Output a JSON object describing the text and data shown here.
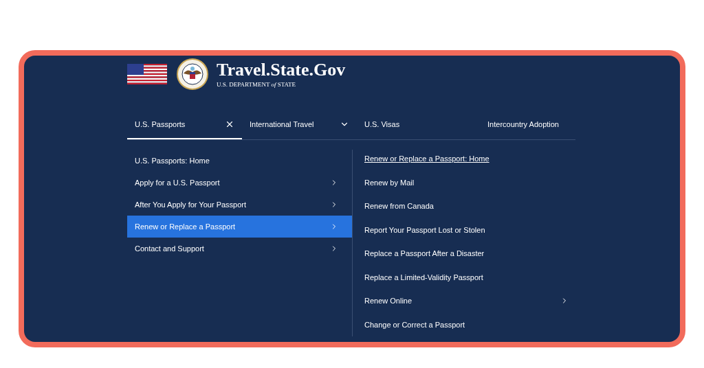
{
  "header": {
    "title": "Travel.State.Gov",
    "subtitle": "U.S. DEPARTMENT *of* STATE"
  },
  "tabs": [
    {
      "label": "U.S. Passports",
      "selected": true,
      "kind": "closable"
    },
    {
      "label": "International Travel",
      "selected": false,
      "kind": "dropdown"
    },
    {
      "label": "U.S. Visas",
      "selected": false,
      "kind": "plain"
    },
    {
      "label": "Intercountry Adoption",
      "selected": false,
      "kind": "plain"
    }
  ],
  "menu": [
    {
      "label": "U.S. Passports: Home",
      "selected": false,
      "has_submenu": false
    },
    {
      "label": "Apply for a U.S. Passport",
      "selected": false,
      "has_submenu": true
    },
    {
      "label": "After You Apply for Your Passport",
      "selected": false,
      "has_submenu": true
    },
    {
      "label": "Renew or Replace a Passport",
      "selected": true,
      "has_submenu": true
    },
    {
      "label": "Contact and Support",
      "selected": false,
      "has_submenu": true
    }
  ],
  "submenu": [
    {
      "label": "Renew or Replace a Passport: Home",
      "underlined": true,
      "has_submenu": false
    },
    {
      "label": "Renew by Mail",
      "underlined": false,
      "has_submenu": false
    },
    {
      "label": "Renew from Canada",
      "underlined": false,
      "has_submenu": false
    },
    {
      "label": "Report Your Passport Lost or Stolen",
      "underlined": false,
      "has_submenu": false
    },
    {
      "label": "Replace a Passport After a Disaster",
      "underlined": false,
      "has_submenu": false
    },
    {
      "label": "Replace a Limited-Validity Passport",
      "underlined": false,
      "has_submenu": false
    },
    {
      "label": "Renew Online",
      "underlined": false,
      "has_submenu": true
    },
    {
      "label": "Change or Correct a Passport",
      "underlined": false,
      "has_submenu": false
    }
  ]
}
